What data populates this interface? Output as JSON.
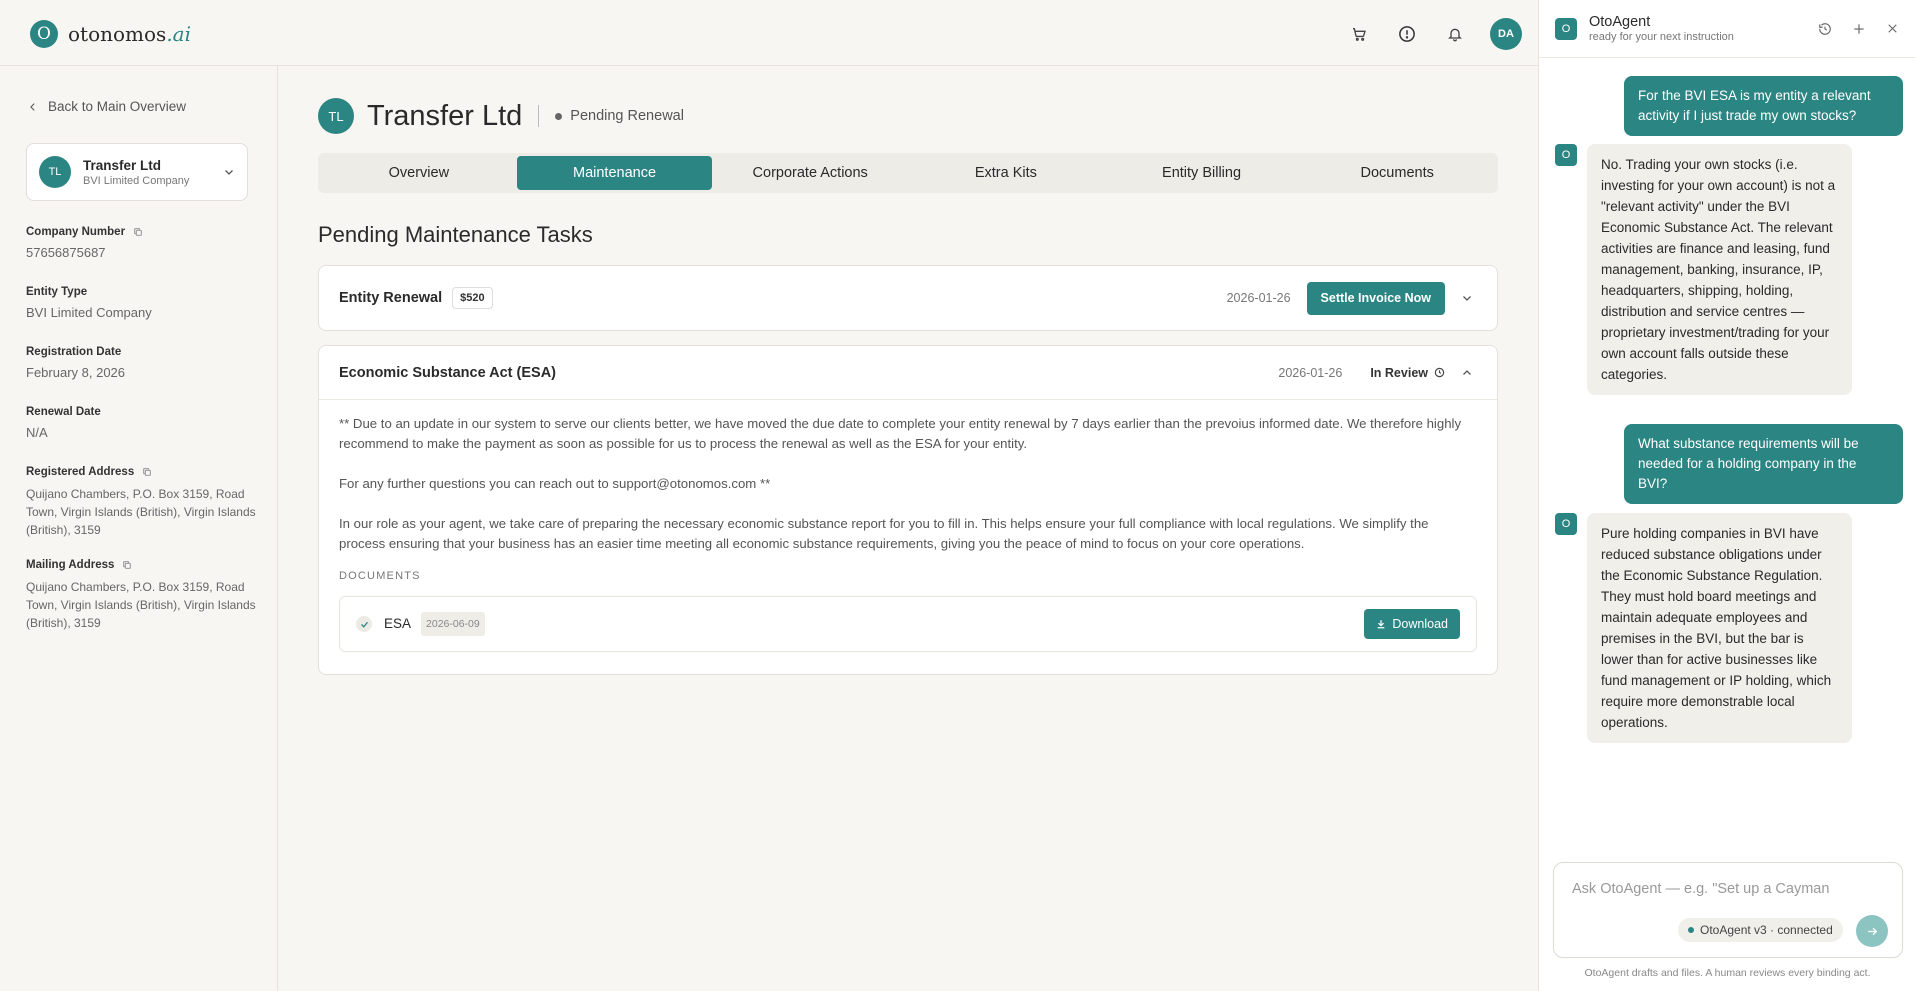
{
  "app": {
    "logo_mark": "O",
    "logo_name": "otonomos",
    "logo_suffix": ".ai",
    "user_initials": "DA",
    "accent": "#2b8583"
  },
  "top_icons": [
    "cart-icon",
    "alert-circle-icon",
    "bell-icon"
  ],
  "sidebar": {
    "back_label": "Back to Main Overview",
    "entity": {
      "initials": "TL",
      "name": "Transfer Ltd",
      "type": "BVI Limited Company"
    },
    "fields": {
      "company_number": {
        "label": "Company Number",
        "value": "57656875687"
      },
      "entity_type": {
        "label": "Entity Type",
        "value": "BVI Limited Company"
      },
      "registration_date": {
        "label": "Registration Date",
        "value": "February 8, 2026"
      },
      "renewal_date": {
        "label": "Renewal Date",
        "value": "N/A"
      },
      "registered_address": {
        "label": "Registered Address",
        "value": "Quijano Chambers, P.O. Box 3159, Road Town, Virgin Islands (British), Virgin Islands (British), 3159"
      },
      "mailing_address": {
        "label": "Mailing Address",
        "value": "Quijano Chambers, P.O. Box 3159, Road Town, Virgin Islands (British), Virgin Islands (British), 3159"
      }
    }
  },
  "main": {
    "header": {
      "initials": "TL",
      "title": "Transfer Ltd",
      "status": "Pending Renewal"
    },
    "tabs": [
      {
        "label": "Overview",
        "active": false
      },
      {
        "label": "Maintenance",
        "active": true
      },
      {
        "label": "Corporate Actions",
        "active": false
      },
      {
        "label": "Extra Kits",
        "active": false
      },
      {
        "label": "Entity Billing",
        "active": false
      },
      {
        "label": "Documents",
        "active": false
      }
    ],
    "section_title": "Pending Maintenance Tasks",
    "tasks": {
      "renewal": {
        "title": "Entity Renewal",
        "price": "$520",
        "date": "2026-01-26",
        "action_label": "Settle Invoice Now"
      },
      "esa": {
        "title": "Economic Substance Act (ESA)",
        "date": "2026-01-26",
        "status": "In Review",
        "paragraphs": [
          "** Due to an update in our system to serve our clients better, we have moved the due date to complete your entity renewal by 7 days earlier than the prevoius informed date. We therefore highly recommend to make the payment as soon as possible for us to process the renewal as well as the ESA for your entity.",
          "For any further questions you can reach out to support@otonomos.com **",
          "In our role as your agent, we take care of preparing the necessary economic substance report for you to fill in. This helps ensure your full compliance with local regulations. We simplify the process ensuring that your business has an easier time meeting all economic substance requirements, giving you the peace of mind to focus on your core operations."
        ],
        "documents_label": "DOCUMENTS",
        "document": {
          "name": "ESA",
          "date": "2026-06-09",
          "action_label": "Download"
        }
      }
    }
  },
  "chat": {
    "bot_mark": "O",
    "title": "OtoAgent",
    "subtitle": "ready for your next instruction",
    "messages": [
      {
        "role": "user",
        "text": "For the BVI ESA is my entity a relevant activity if I just trade my own stocks?"
      },
      {
        "role": "bot",
        "text": "No. Trading your own stocks (i.e. investing for your own account) is not a \"relevant activity\" under the BVI Economic Substance Act. The relevant activities are finance and leasing, fund management, banking, insurance, IP, headquarters, shipping, holding, distribution and service centres — proprietary investment/trading for your own account falls outside these categories."
      },
      {
        "role": "user",
        "text": "What substance requirements will be needed for a holding company in the BVI?"
      },
      {
        "role": "bot",
        "text": "Pure holding companies in BVI have reduced substance obligations under the Economic Substance Regulation. They must hold board meetings and maintain adequate employees and premises in the BVI, but the bar is lower than for active businesses like fund management or IP holding, which require more demonstrable local operations."
      }
    ],
    "input_placeholder": "Ask OtoAgent — e.g. \"Set up a Cayman",
    "connection_label": "OtoAgent v3 · connected",
    "disclaimer": "OtoAgent drafts and files. A human reviews every binding act."
  }
}
